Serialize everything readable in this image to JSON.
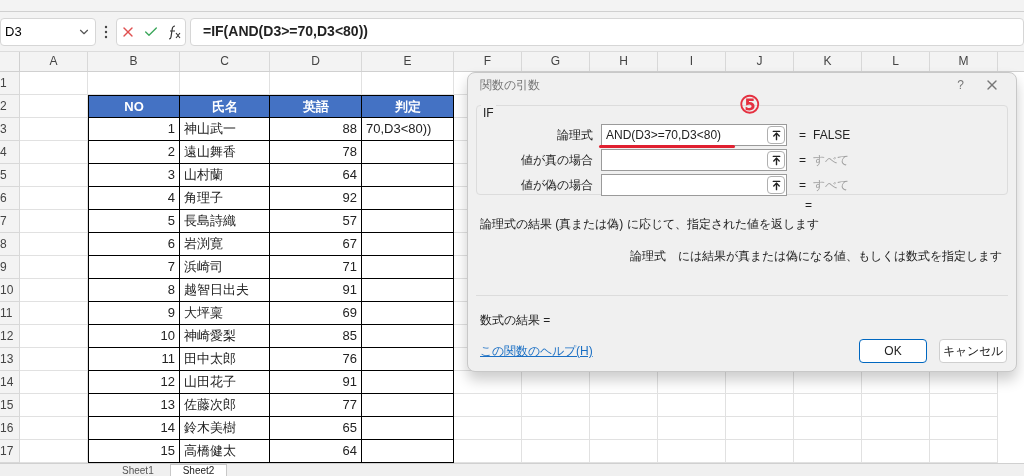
{
  "name_box": "D3",
  "formula_bar": {
    "formula": "=IF(AND(D3>=70,D3<80))"
  },
  "columns": [
    "A",
    "B",
    "C",
    "D",
    "E",
    "F",
    "G",
    "H",
    "I",
    "J",
    "K",
    "L",
    "M"
  ],
  "rows": [
    "1",
    "2",
    "3",
    "4",
    "5",
    "6",
    "7",
    "8",
    "9",
    "10",
    "11",
    "12",
    "13",
    "14",
    "15",
    "16",
    "17"
  ],
  "table": {
    "headers": [
      "NO",
      "氏名",
      "英語",
      "判定"
    ],
    "rows": [
      {
        "no": "1",
        "name": "神山武一",
        "english": "88",
        "result": "70,D3<80))"
      },
      {
        "no": "2",
        "name": "遠山舞香",
        "english": "78"
      },
      {
        "no": "3",
        "name": "山村蘭",
        "english": "64"
      },
      {
        "no": "4",
        "name": "角理子",
        "english": "92"
      },
      {
        "no": "5",
        "name": "長島詩織",
        "english": "57"
      },
      {
        "no": "6",
        "name": "岩渕寛",
        "english": "67"
      },
      {
        "no": "7",
        "name": "浜崎司",
        "english": "71"
      },
      {
        "no": "8",
        "name": "越智日出夫",
        "english": "91"
      },
      {
        "no": "9",
        "name": "大坪稟",
        "english": "69"
      },
      {
        "no": "10",
        "name": "神崎愛梨",
        "english": "85"
      },
      {
        "no": "11",
        "name": "田中太郎",
        "english": "76"
      },
      {
        "no": "12",
        "name": "山田花子",
        "english": "91"
      },
      {
        "no": "13",
        "name": "佐藤次郎",
        "english": "77"
      },
      {
        "no": "14",
        "name": "鈴木美樹",
        "english": "65"
      },
      {
        "no": "15",
        "name": "高橋健太",
        "english": "64"
      }
    ]
  },
  "dialog": {
    "title": "関数の引数",
    "help": "?",
    "function_name": "IF",
    "annotation": "⑤",
    "arguments": [
      {
        "label": "論理式",
        "value": "AND(D3>=70,D3<80)",
        "equals": "=",
        "result": "FALSE",
        "dimmed": false,
        "underlined": true
      },
      {
        "label": "値が真の場合",
        "equals": "=",
        "result": "すべて",
        "dimmed": true,
        "underlined": false
      },
      {
        "label": "値が偽の場合",
        "equals": "=",
        "result": "すべて",
        "dimmed": true,
        "underlined": false
      }
    ],
    "formula_equals": "=",
    "description": "論理式の結果 (真または偽) に応じて、指定された値を返します",
    "argument_help": {
      "name": "論理式",
      "text": "には結果が真または偽になる値、もしくは数式を指定します"
    },
    "result_label": "数式の結果 =",
    "help_link": "この関数のヘルプ(H)",
    "buttons": [
      {
        "label": "OK",
        "default": true
      },
      {
        "label": "キャンセル",
        "default": false
      }
    ]
  },
  "sheet_tabs": [
    {
      "label": "Sheet1",
      "selected": false
    },
    {
      "label": "Sheet2",
      "selected": true
    }
  ]
}
